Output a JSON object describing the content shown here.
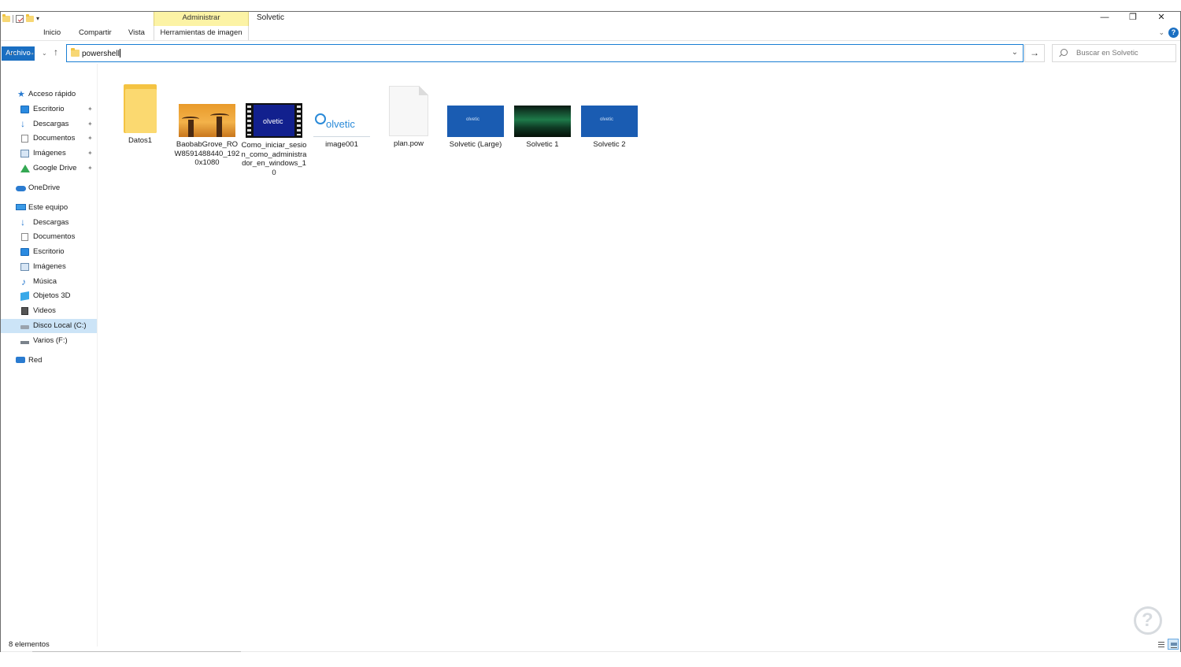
{
  "window": {
    "title": "Solvetic",
    "contextual_group": "Administrar",
    "controls": {
      "minimize": "—",
      "maximize": "❐",
      "close": "✕"
    }
  },
  "ribbon": {
    "tabs": [
      {
        "label": "Archivo"
      },
      {
        "label": "Inicio"
      },
      {
        "label": "Compartir"
      },
      {
        "label": "Vista"
      },
      {
        "label": "Herramientas de imagen"
      }
    ],
    "collapse_icon": "chevron-down-icon",
    "help_label": "?"
  },
  "navigation": {
    "back_icon": "←",
    "forward_icon": "→",
    "recent_icon": "⌄",
    "up_icon": "↑",
    "address_value": "powershell",
    "address_dropdown_icon": "⌄",
    "go_icon": "→",
    "search_placeholder": "Buscar en Solvetic"
  },
  "sidebar": {
    "items": [
      {
        "label": "Acceso rápido",
        "icon": "star-icon"
      },
      {
        "label": "Escritorio",
        "icon": "desktop-icon",
        "pinned": true
      },
      {
        "label": "Descargas",
        "icon": "download-icon",
        "pinned": true
      },
      {
        "label": "Documentos",
        "icon": "documents-icon",
        "pinned": true
      },
      {
        "label": "Imágenes",
        "icon": "pictures-icon",
        "pinned": true
      },
      {
        "label": "Google Drive",
        "icon": "google-drive-icon",
        "pinned": true
      },
      {
        "label": "OneDrive",
        "icon": "onedrive-icon"
      },
      {
        "label": "Este equipo",
        "icon": "this-pc-icon"
      },
      {
        "label": "Descargas",
        "icon": "download-icon"
      },
      {
        "label": "Documentos",
        "icon": "documents-icon"
      },
      {
        "label": "Escritorio",
        "icon": "desktop-icon"
      },
      {
        "label": "Imágenes",
        "icon": "pictures-icon"
      },
      {
        "label": "Música",
        "icon": "music-icon"
      },
      {
        "label": "Objetos 3D",
        "icon": "3d-objects-icon"
      },
      {
        "label": "Videos",
        "icon": "videos-icon"
      },
      {
        "label": "Disco Local (C:)",
        "icon": "local-disk-icon",
        "selected": true
      },
      {
        "label": "Varios (F:)",
        "icon": "drive-icon"
      },
      {
        "label": "Red",
        "icon": "network-icon"
      }
    ],
    "pin_glyph": "📌"
  },
  "files": [
    {
      "name": "Datos1",
      "kind": "folder"
    },
    {
      "name": "BaobabGrove_ROW8591488440_1920x1080",
      "kind": "image"
    },
    {
      "name": "Como_iniciar_sesion_como_administrador_en_windows_10",
      "kind": "video",
      "thumb_text": "olvetic"
    },
    {
      "name": "image001",
      "kind": "image-logo",
      "thumb_text": "olvetic"
    },
    {
      "name": "plan.pow",
      "kind": "document"
    },
    {
      "name": "Solvetic (Large)",
      "kind": "image-blue",
      "thumb_text": "olvetic"
    },
    {
      "name": "Solvetic 1",
      "kind": "image-aurora"
    },
    {
      "name": "Solvetic 2",
      "kind": "image-blue",
      "thumb_text": "olvetic"
    }
  ],
  "status": {
    "item_count": "8 elementos"
  },
  "colors": {
    "accent": "#1a6fc2",
    "contextual_tab": "#fcf3a5",
    "selection": "#cce4f7"
  }
}
